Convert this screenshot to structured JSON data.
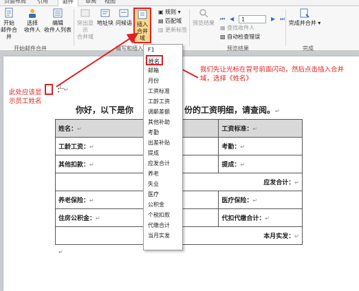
{
  "tabs": {
    "page_layout": "页面布局",
    "references": "引用",
    "mailings": "邮件",
    "review": "审阅",
    "view": "视图"
  },
  "ribbon": {
    "start_merge": "开始",
    "start_merge_sub": "邮件合并",
    "select_recipients": "选择",
    "select_recipients_sub": "收件人",
    "edit_recipients": "编辑",
    "edit_recipients_sub": "收件人列表",
    "highlight_fields": "突出显示",
    "highlight_fields_sub": "合并域",
    "address_block": "地址块",
    "greeting_line": "问候语",
    "insert_field": "插入",
    "insert_field_sub": "合并域",
    "rules": "规则",
    "match_fields": "匹配域",
    "update_labels": "更新标签",
    "preview_results": "预览结果",
    "record_no": "1",
    "find_recipient": "查找收件人",
    "auto_check_errors": "自动检查错误",
    "finish_merge": "完成并合并",
    "group_start": "开始邮件合并",
    "group_write": "编写和插入",
    "group_preview": "预览结果",
    "group_finish": "完成"
  },
  "menu_items": [
    "F1",
    "姓名",
    "邮箱",
    "月份",
    "工资标准",
    "工龄工资",
    "调薪差额",
    "其他补助",
    "考勤",
    "出差补贴",
    "提成",
    "应发合计",
    "养老",
    "失业",
    "医疗",
    "公积金",
    "个税扣款",
    "代缴合计",
    "当月实发"
  ],
  "annotations": {
    "left_note": "此处应该显示员工姓名",
    "right_note": "我们先让光标在冒号前面闪动，然后点击插入合并域，选择《姓名》"
  },
  "document": {
    "colon": "：",
    "greeting": "你好，以下是你",
    "greeting_tail": "份的工资明细，请查阅。",
    "return_mark": "↵",
    "name_label": "姓名：",
    "salary_std": "工资标准：",
    "seniority": "工龄工资：",
    "attendance": "考勤：",
    "other_deduct": "其他扣款：",
    "commission": "提成：",
    "gross_total": "应发合计：",
    "pension": "养老保险：",
    "medical": "医疗保险：",
    "housing": "住房公积金：",
    "withheld_total": "代扣代缴合计：",
    "net_pay": "本月实发："
  }
}
